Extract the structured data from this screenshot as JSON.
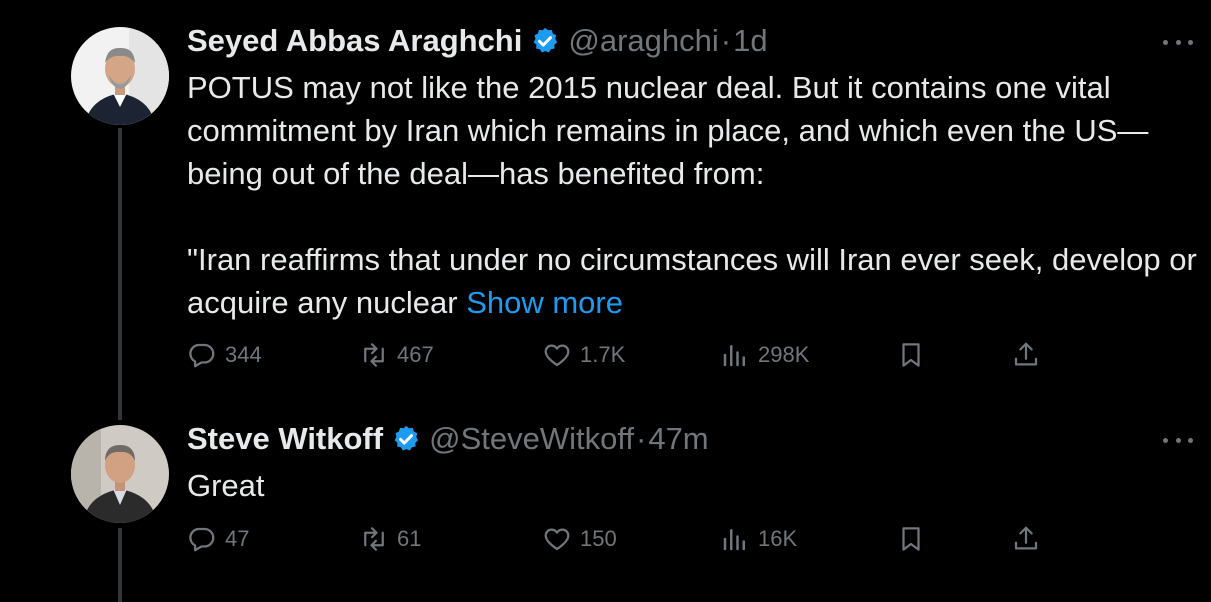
{
  "tweets": [
    {
      "name": "Seyed Abbas Araghchi",
      "handle": "@araghchi",
      "separator": "·",
      "time": "1d",
      "text_para1": "POTUS may not like the 2015 nuclear deal. But it contains one vital commitment by Iran which remains in place, and which even the US—being out of the deal—has benefited from:",
      "text_para2": "\"Iran reaffirms that under no circumstances will Iran ever seek, develop or acquire any nuclear",
      "show_more": "Show more",
      "replies": "344",
      "reposts": "467",
      "likes": "1.7K",
      "views": "298K"
    },
    {
      "name": "Steve Witkoff",
      "handle": "@SteveWitkoff",
      "separator": "·",
      "time": "47m",
      "text": "Great",
      "replies": "47",
      "reposts": "61",
      "likes": "150",
      "views": "16K"
    }
  ],
  "icons": {
    "verified": "verified-badge-icon",
    "more": "more-dots-icon",
    "reply": "reply-icon",
    "repost": "repost-icon",
    "like": "heart-icon",
    "views": "views-icon",
    "bookmark": "bookmark-icon",
    "share": "share-icon"
  },
  "colors": {
    "background": "#000000",
    "text": "#e7e9ea",
    "muted": "#71767b",
    "accent": "#1d9bf0",
    "thread_line": "#333639"
  }
}
